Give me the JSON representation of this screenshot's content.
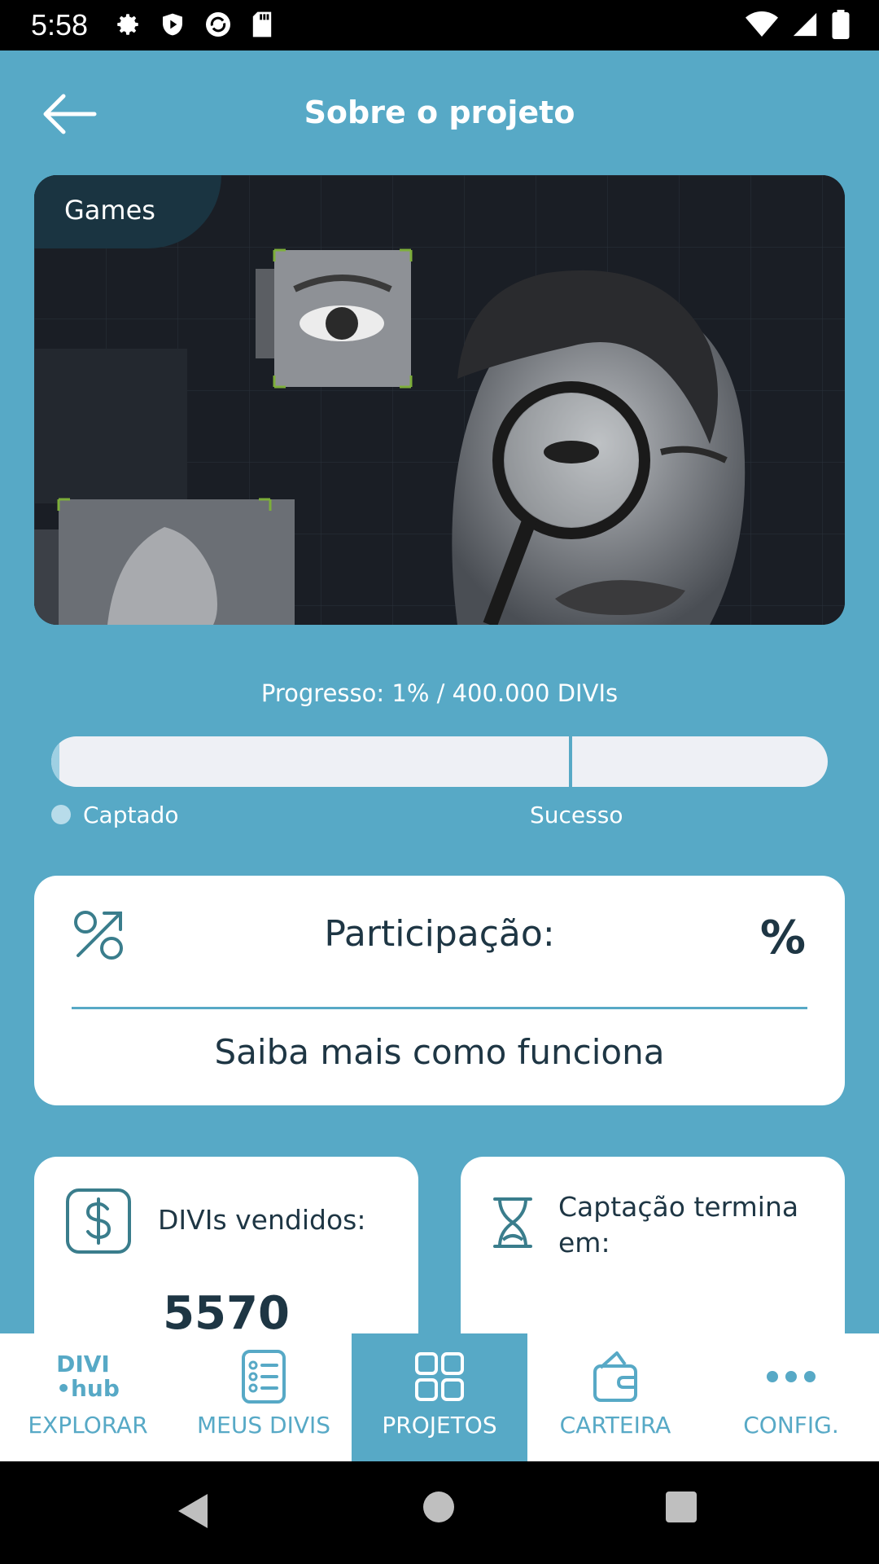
{
  "status_bar": {
    "time": "5:58",
    "left_icons": [
      "gear-icon",
      "shield-icon",
      "sync-icon",
      "sd-card-icon"
    ],
    "right_icons": [
      "wifi-icon",
      "signal-icon",
      "battery-icon"
    ]
  },
  "header": {
    "title": "Sobre o projeto",
    "back_icon": "arrow-left-icon"
  },
  "hero": {
    "category": "Games"
  },
  "progress": {
    "label": "Progresso: 1% / 400.000 DIVIs",
    "percent": 1,
    "success_marker_fraction": 0.667,
    "legend_captado": "Captado",
    "legend_sucesso": "Sucesso"
  },
  "participation": {
    "label": "Participação:",
    "value": "%",
    "link": "Saiba mais como funciona"
  },
  "stats": {
    "sold_label": "DIVIs vendidos:",
    "sold_value": "5570",
    "deadline_label": "Captação termina em:"
  },
  "bottom_nav": {
    "items": [
      {
        "label": "EXPLORAR",
        "logo_line1": "DIVI",
        "logo_line2": "•hub"
      },
      {
        "label": "MEUS DIVIS"
      },
      {
        "label": "PROJETOS",
        "active": true
      },
      {
        "label": "CARTEIRA"
      },
      {
        "label": "CONFIG."
      }
    ]
  },
  "colors": {
    "background": "#57a9c6",
    "dark_text": "#1e3644",
    "card": "#ffffff"
  }
}
